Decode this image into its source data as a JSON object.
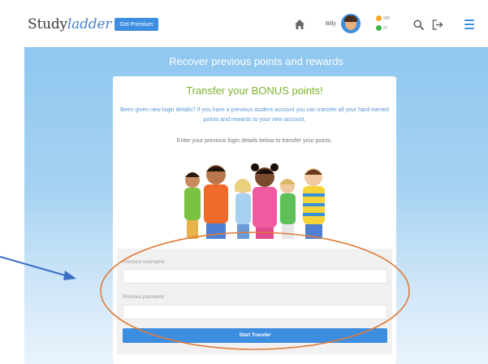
{
  "header": {
    "logo_study": "Study",
    "logo_ladder": "ladder",
    "premium_label": "Get Premium",
    "user_name": "Billy",
    "stat_points": "950",
    "stat_awards": "37",
    "icons": [
      "home-icon",
      "avatar",
      "search-icon",
      "logout-icon",
      "menu-icon"
    ]
  },
  "panel": {
    "title": "Recover previous points and rewards"
  },
  "card": {
    "heading": "Transfer your BONUS points!",
    "description": "Been given new login details? If you have a previous student account you can transfer all your hard earned points and rewards to your new account.",
    "instruction": "Enter your previous login details below to transfer your points."
  },
  "form": {
    "username_label": "Previous username",
    "username_value": "",
    "password_label": "Previous password",
    "password_value": "",
    "submit_label": "Start Transfer"
  },
  "colors": {
    "brand_blue": "#3d8de0",
    "heading_green": "#7cb22d",
    "description_blue": "#5a96d4",
    "annotation_orange": "#e07b39",
    "annotation_arrow": "#3a6fc4"
  }
}
